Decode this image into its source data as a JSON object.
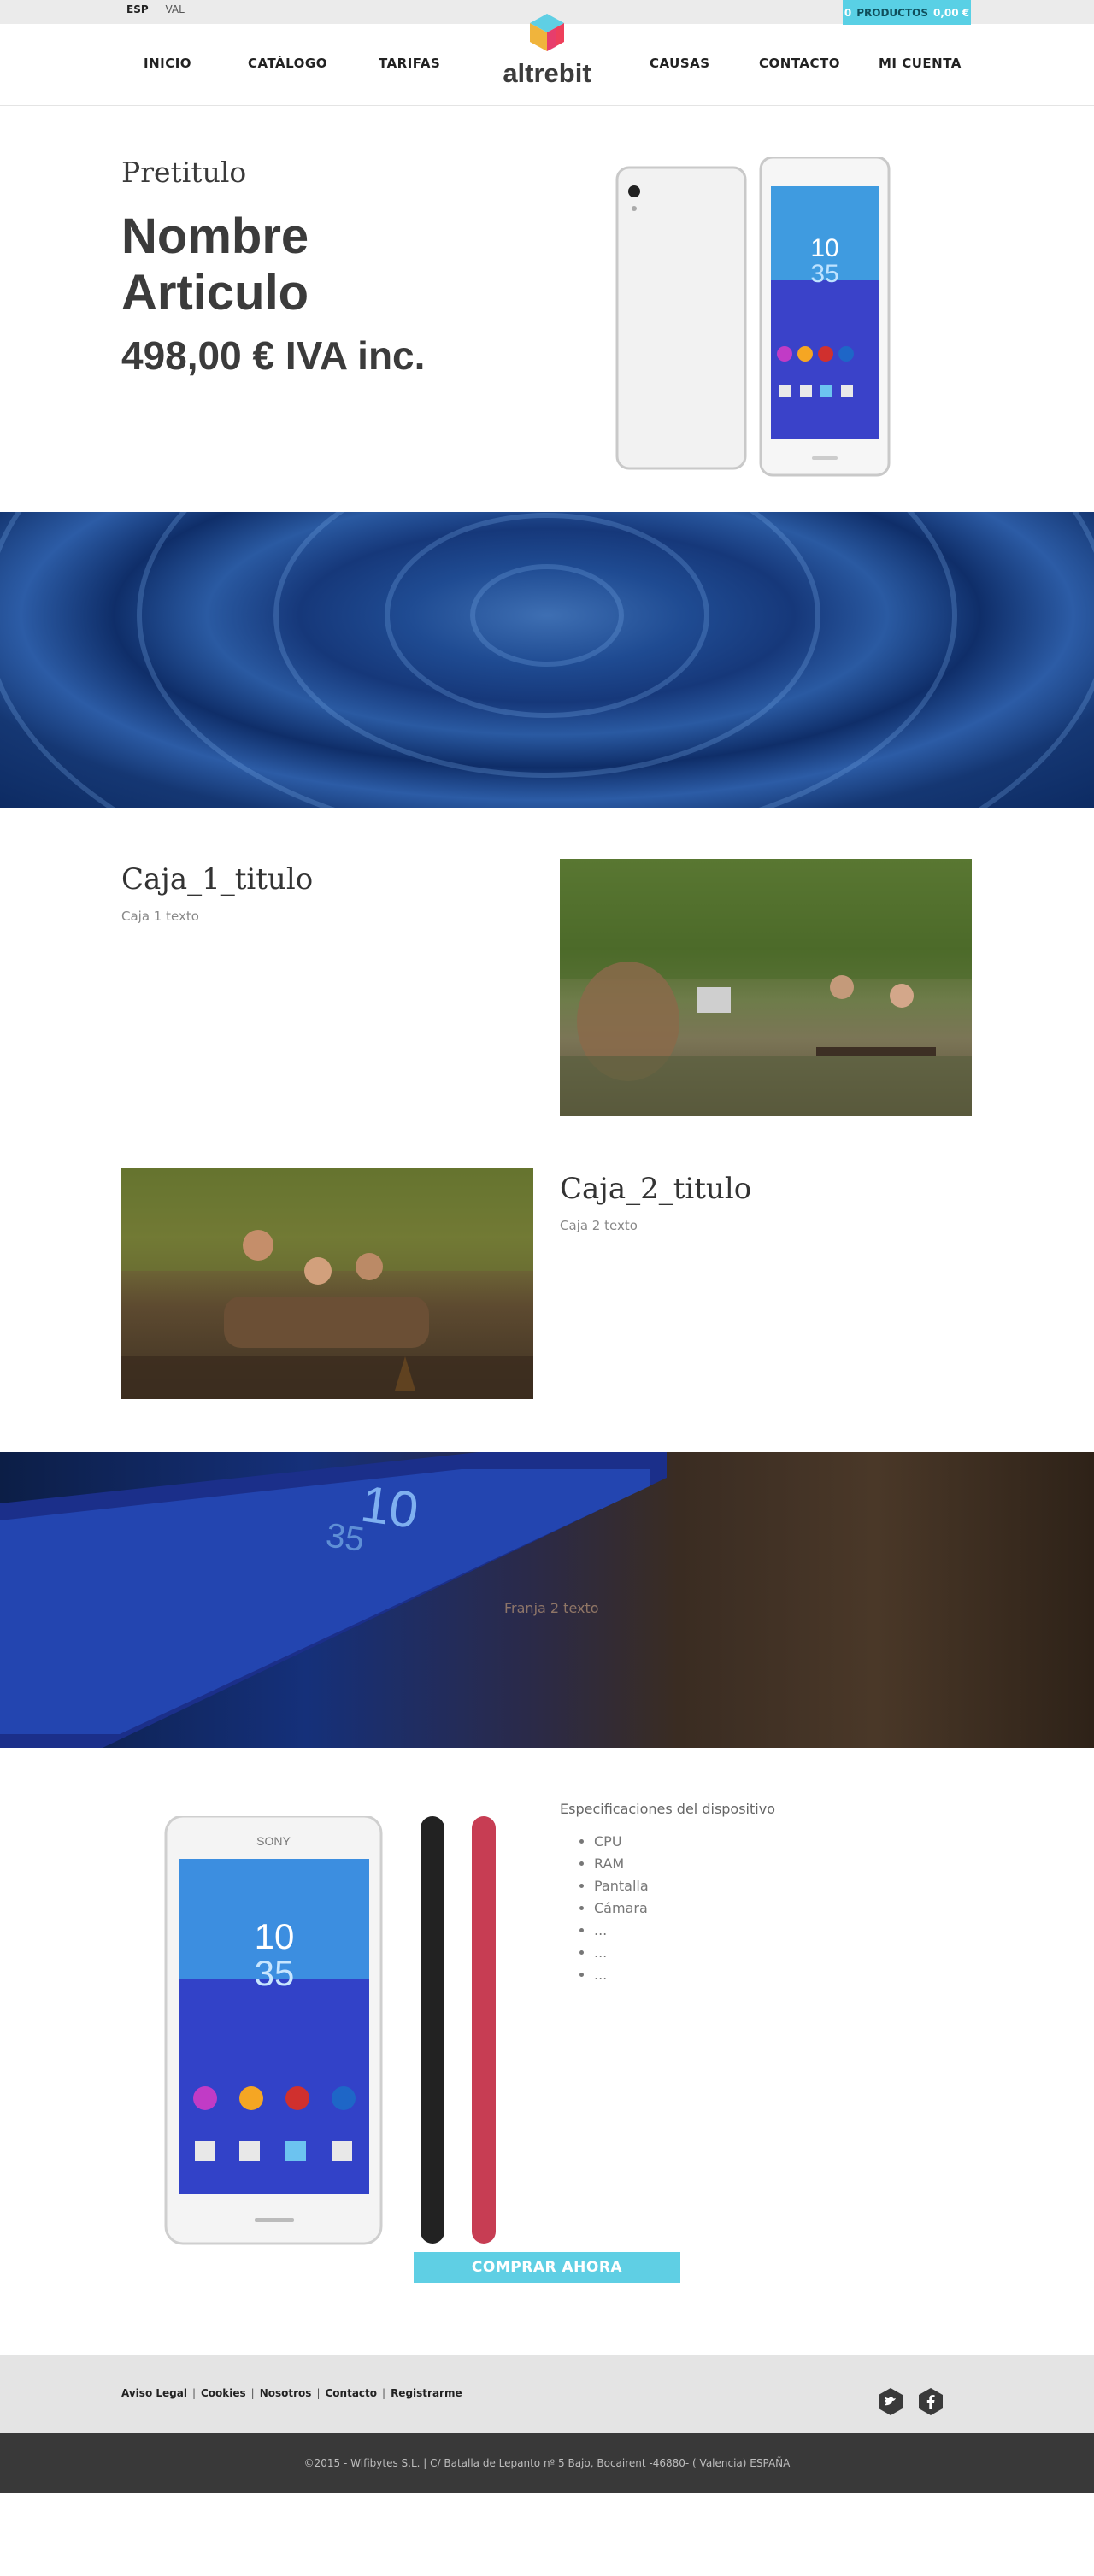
{
  "topbar": {
    "languages": [
      {
        "label": "ESP",
        "active": true
      },
      {
        "label": "VAL",
        "active": false
      }
    ],
    "cart": {
      "count": "0",
      "label": "PRODUCTOS",
      "total": "0,00 €"
    }
  },
  "nav": {
    "items": [
      "INICIO",
      "CATÁLOGO",
      "TARIFAS",
      "CAUSAS",
      "CONTACTO",
      "MI CUENTA"
    ],
    "logo_text": "altrebit"
  },
  "hero": {
    "pretitle": "Pretitulo",
    "name": "Nombre Articulo",
    "price": "498,00 € IVA inc."
  },
  "hero_phone": {
    "screen_hour": "10",
    "screen_min": "35"
  },
  "boxes": [
    {
      "title": "Caja_1_titulo",
      "text": "Caja 1 texto"
    },
    {
      "title": "Caja_2_titulo",
      "text": "Caja 2 texto"
    }
  ],
  "band_phone": {
    "screen_hour": "10",
    "screen_min": "35",
    "text": "Franja 2 texto"
  },
  "specs": {
    "title": "Especificaciones del dispositivo",
    "items": [
      "CPU",
      "RAM",
      "Pantalla",
      "Cámara",
      "...",
      "...",
      "..."
    ],
    "screen_hour": "10",
    "screen_min": "35",
    "brand": "SONY"
  },
  "buy": {
    "label": "COMPRAR AHORA"
  },
  "footer": {
    "links": [
      "Aviso Legal",
      "Cookies",
      "Nosotros",
      "Contacto",
      "Registrarme"
    ],
    "copyright": "©2015 - Wifibytes S.L. | C/ Batalla de Lepanto nº 5 Bajo, Bocairent -46880- ( Valencia) ESPAÑA"
  },
  "colors": {
    "accent": "#5fcfe4",
    "footer_bg": "#e4e4e4",
    "bottom_bg": "#393939",
    "text_dark": "#3b3b3b"
  },
  "icons": [
    "logo-cube-icon",
    "twitter-icon",
    "facebook-icon"
  ]
}
